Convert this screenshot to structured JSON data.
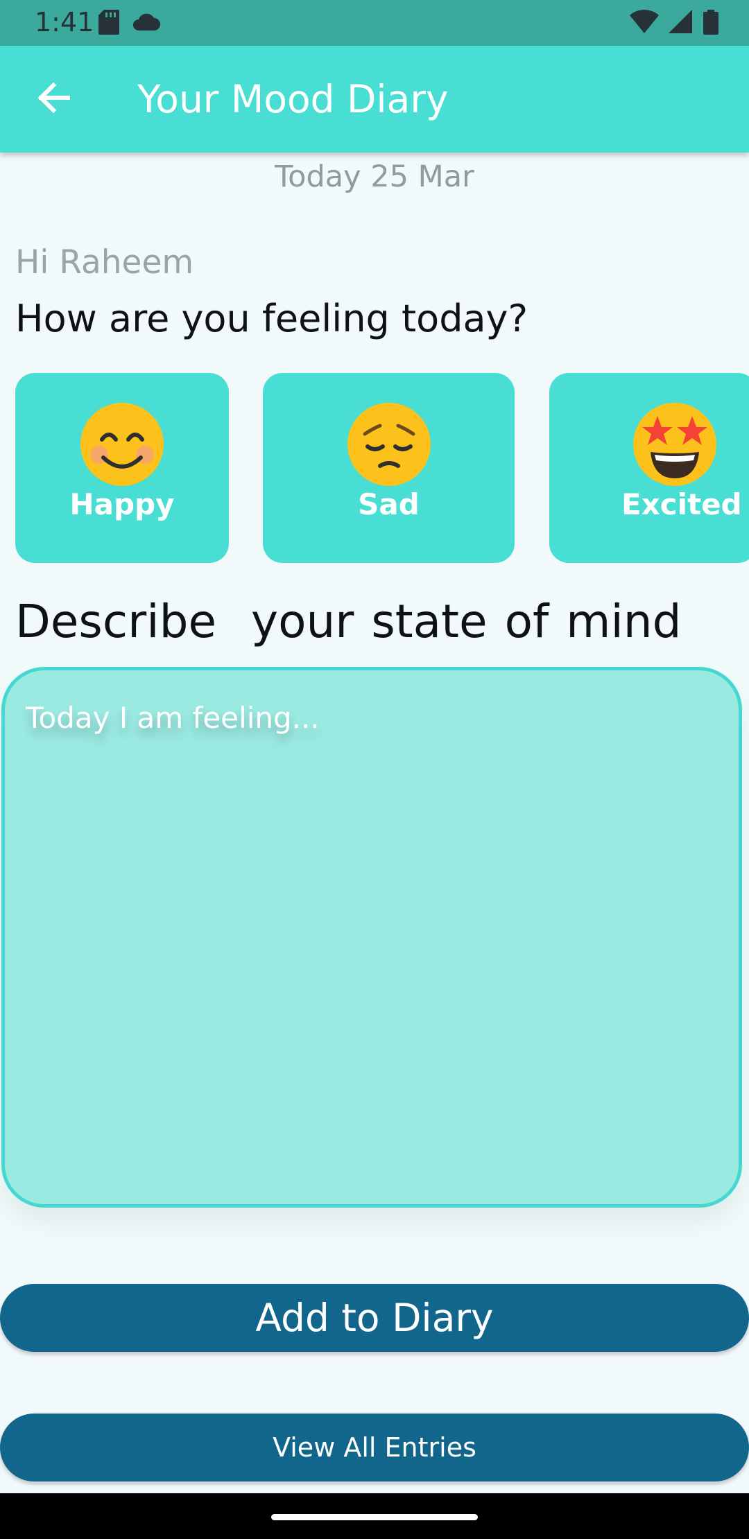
{
  "status_bar": {
    "time": "1:41",
    "left_icons": [
      "sd-card-icon",
      "cloud-icon"
    ],
    "right_icons": [
      "wifi-icon",
      "signal-icon",
      "battery-icon"
    ],
    "background": "#3ba99c"
  },
  "app_bar": {
    "title": "Your Mood Diary",
    "back_icon": "arrow-back-icon",
    "background": "#49ded3"
  },
  "date_label": "Today 25 Mar",
  "greeting": "Hi Raheem",
  "question": "How are you feeling today?",
  "moods": [
    {
      "label": "Happy",
      "emoji": "😊",
      "icon": "smiling-face-icon"
    },
    {
      "label": "Sad",
      "emoji": "😔",
      "icon": "pensive-face-icon"
    },
    {
      "label": "Excited",
      "emoji": "🤩",
      "icon": "star-struck-face-icon"
    }
  ],
  "describe_label": "Describe  your state of mind",
  "diary_input": {
    "placeholder": "Today I am feeling...",
    "value": ""
  },
  "buttons": {
    "add": "Add to Diary",
    "view_all": "View All Entries"
  },
  "colors": {
    "accent": "#49ded3",
    "field_bg": "#9aeae2",
    "button": "#12668b",
    "page_bg": "#f2f9fb"
  }
}
